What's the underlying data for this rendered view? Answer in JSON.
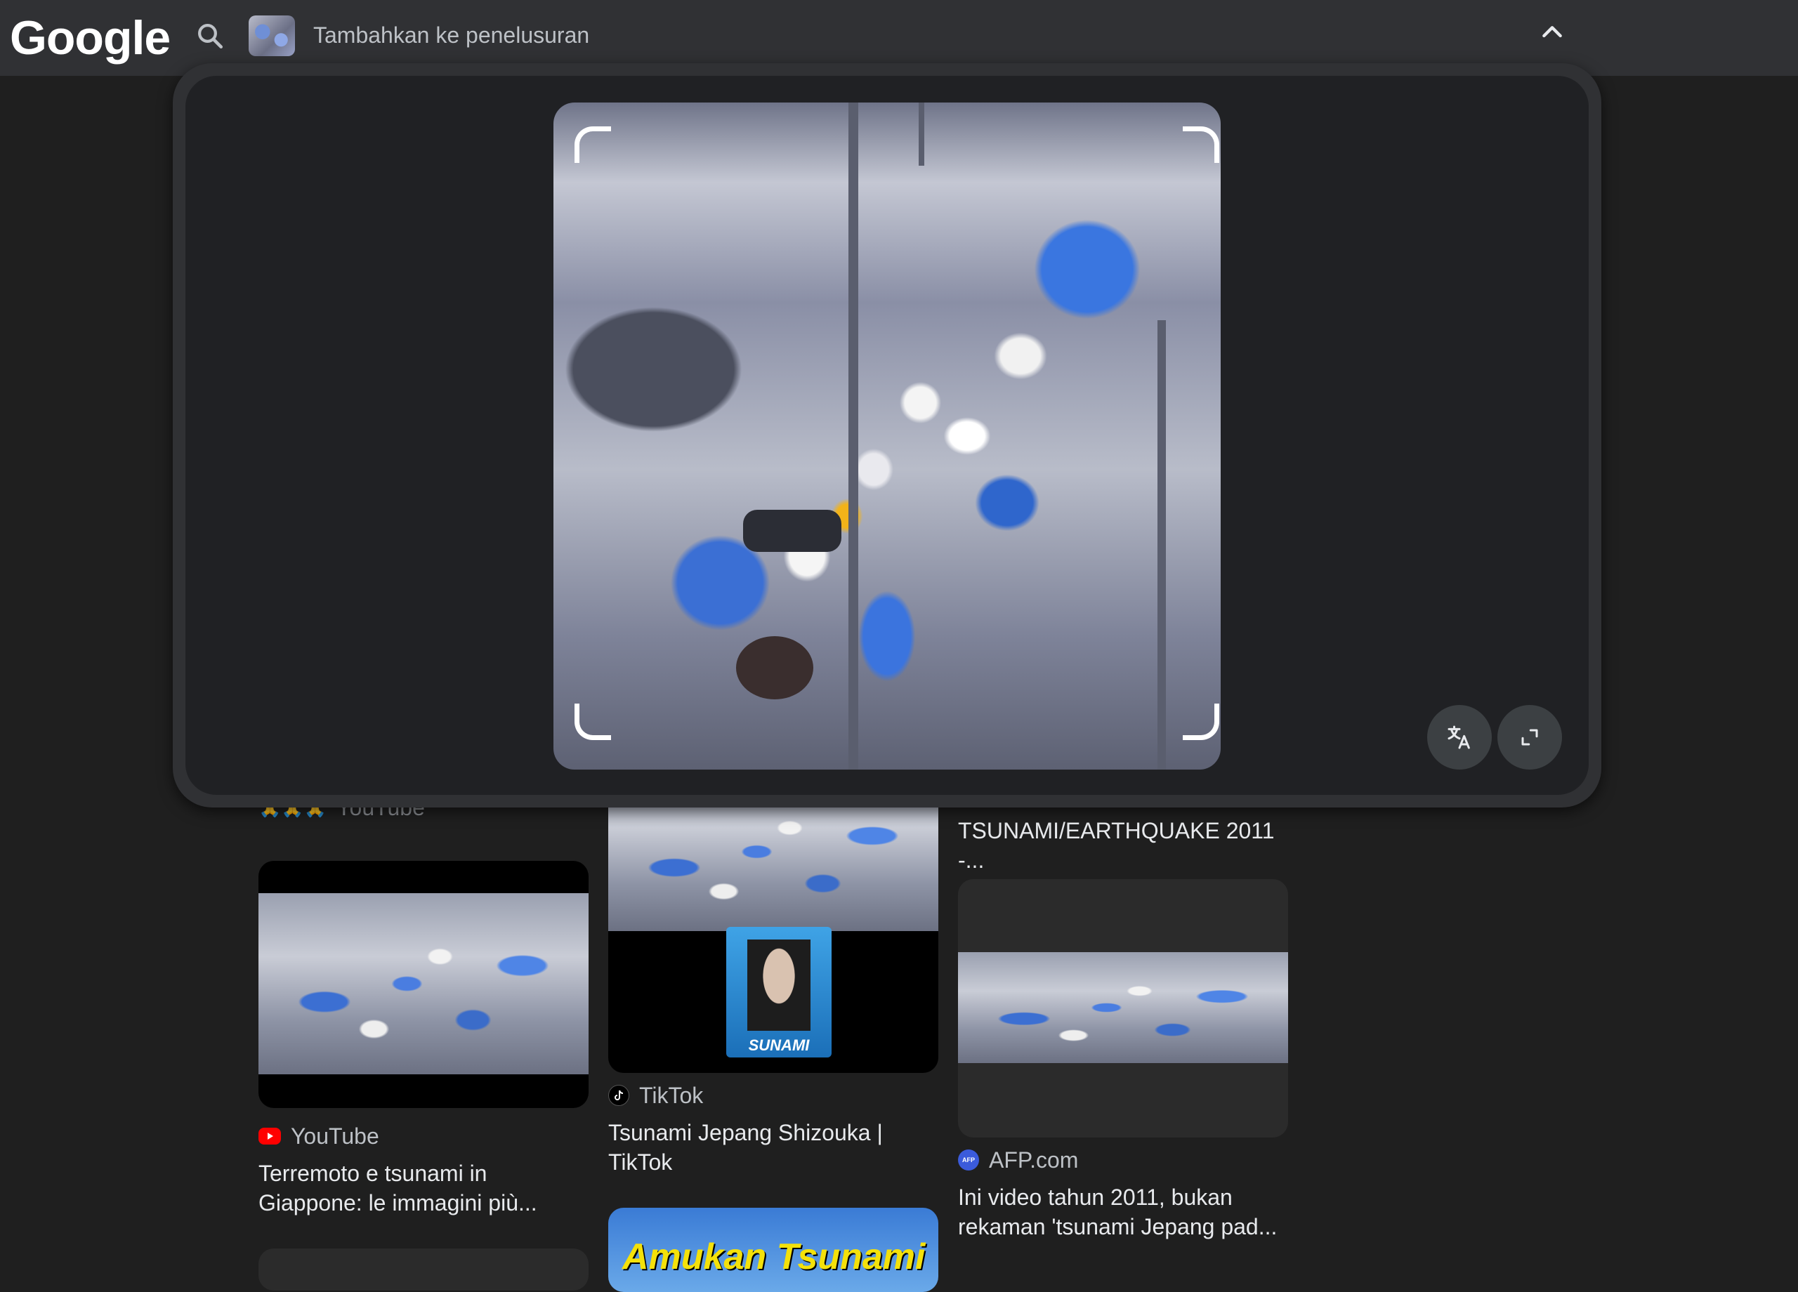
{
  "header": {
    "logo": "Google",
    "search_placeholder": "Tambahkan ke penelusuran"
  },
  "results": {
    "col1_top_source": "YouTube",
    "col1": {
      "source": "YouTube",
      "title": "Terremoto e tsunami in Giappone: le immagini più..."
    },
    "col2": {
      "source": "TikTok",
      "title": "Tsunami Jepang Shizouka | TikTok",
      "thumb_caption": "SUNAMI",
      "next_thumb_text": "Amukan Tsunami"
    },
    "col3": {
      "top_title": "TSUNAMI/EARTHQUAKE 2011 -...",
      "source": "AFP.com",
      "source_badge": "AFP",
      "title": "Ini video tahun 2011, bukan rekaman 'tsunami Jepang pad..."
    }
  },
  "icons": {
    "search": "search-icon",
    "collapse": "chevron-up-icon",
    "translate": "translate-icon",
    "fullscreen": "fullscreen-icon"
  },
  "colors": {
    "header_bg": "#303134",
    "page_bg": "#1f1f1f",
    "youtube_red": "#ff0000",
    "afp_blue": "#3b5bdb"
  }
}
